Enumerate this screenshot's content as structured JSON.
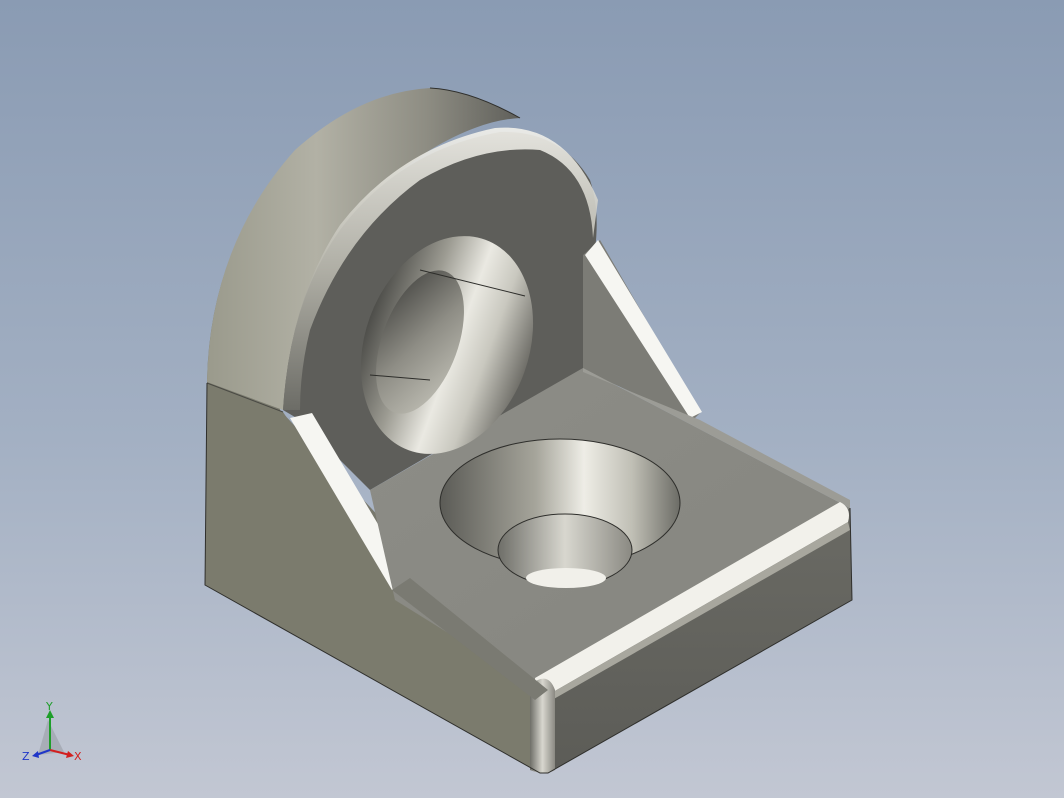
{
  "viewport": {
    "background_top": "#8a9bb3",
    "background_bottom": "#c2c7d3"
  },
  "model": {
    "part": "l-bracket-with-countersunk-holes",
    "body_color": "#7c7c74",
    "face_color": "#8a8a84",
    "highlight_color": "#f4f4f0"
  },
  "triad": {
    "x_label": "X",
    "y_label": "Y",
    "z_label": "Z",
    "x_color": "#d21f1f",
    "y_color": "#1e9e2a",
    "z_color": "#1f36c8"
  }
}
